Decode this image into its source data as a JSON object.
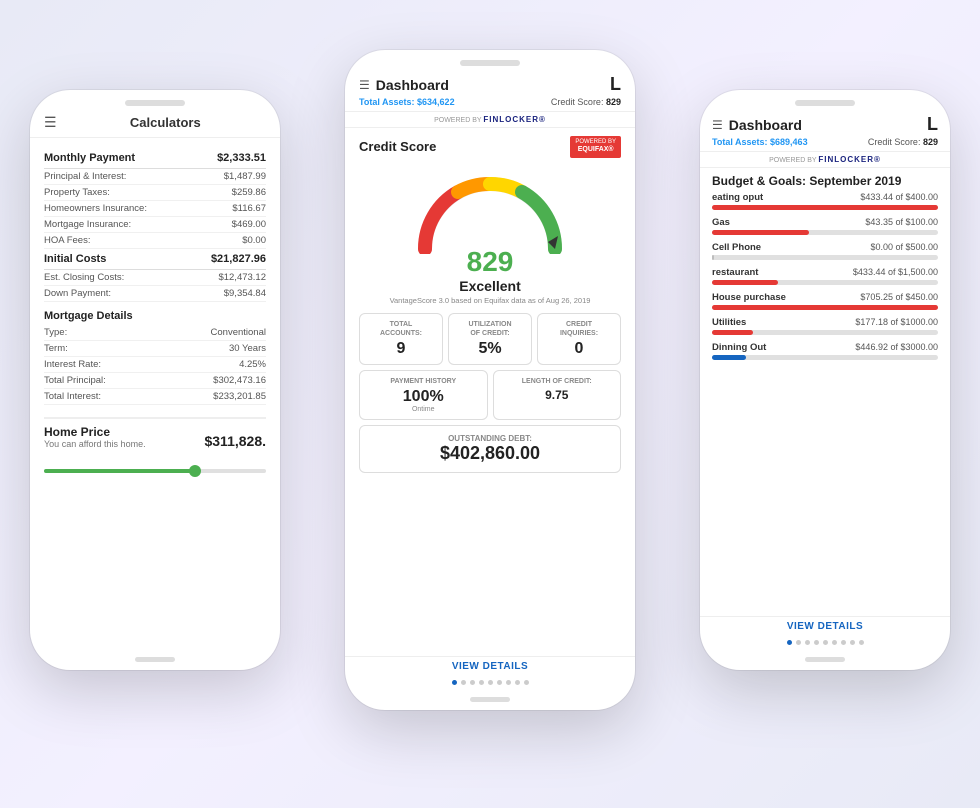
{
  "left_phone": {
    "header": {
      "title": "Calculators"
    },
    "monthly_payment": {
      "label": "Monthly Payment",
      "value": "$2,333.51",
      "rows": [
        {
          "label": "Principal & Interest:",
          "value": "$1,487.99"
        },
        {
          "label": "Property Taxes:",
          "value": "$259.86"
        },
        {
          "label": "Homeowners Insurance:",
          "value": "$116.67"
        },
        {
          "label": "Mortgage Insurance:",
          "value": "$469.00"
        },
        {
          "label": "HOA Fees:",
          "value": "$0.00"
        }
      ]
    },
    "initial_costs": {
      "label": "Initial Costs",
      "value": "$21,827.96",
      "rows": [
        {
          "label": "Est. Closing Costs:",
          "value": "$12,473.12"
        },
        {
          "label": "Down Payment:",
          "value": "$9,354.84"
        }
      ]
    },
    "mortgage_details": {
      "label": "Mortgage Details",
      "rows": [
        {
          "label": "Type:",
          "value": "Conventional"
        },
        {
          "label": "Term:",
          "value": "30 Years"
        },
        {
          "label": "Interest Rate:",
          "value": "4.25%"
        },
        {
          "label": "Total Principal:",
          "value": "$302,473.16"
        },
        {
          "label": "Total Interest:",
          "value": "$233,201.85"
        }
      ]
    },
    "home_price": {
      "label": "Home Price",
      "sub": "You can afford this home.",
      "value": "$311,828."
    }
  },
  "center_phone": {
    "header": {
      "title": "Dashboard",
      "letter": "L",
      "total_assets_label": "Total Assets:",
      "total_assets_value": "$634,622",
      "credit_score_label": "Credit Score:",
      "credit_score_value": "829",
      "powered_by": "POWERED BY",
      "finlocker": "FINLOCKER®"
    },
    "credit_score": {
      "title": "Credit Score",
      "powered_by": "POWERED BY",
      "equifax": "EQUIFAX®",
      "score": "829",
      "rating": "Excellent",
      "sub": "VantageScore 3.0 based on Equifax data as of Aug 26, 2019",
      "stats": [
        {
          "label": "TOTAL\nACCOUNTS:",
          "value": "9",
          "sub": ""
        },
        {
          "label": "UTILIZATION\nOF CREDIT:",
          "value": "5%",
          "sub": ""
        },
        {
          "label": "CREDIT\nINQUIRIES:",
          "value": "0",
          "sub": ""
        }
      ],
      "stats2": [
        {
          "label": "PAYMENT HISTORY",
          "value": "100%",
          "sub": "Ontime"
        },
        {
          "label": "LENGTH OF CREDIT:",
          "value": "9.75",
          "sub": ""
        }
      ],
      "outstanding": {
        "label": "OUTSTANDING DEBT:",
        "value": "$402,860.00"
      },
      "view_details": "VIEW DETAILS"
    },
    "dots": [
      true,
      false,
      false,
      false,
      false,
      false,
      false,
      false,
      false
    ]
  },
  "right_phone": {
    "header": {
      "title": "Dashboard",
      "letter": "L",
      "total_assets_label": "Total Assets:",
      "total_assets_value": "$689,463",
      "credit_score_label": "Credit Score:",
      "credit_score_value": "829",
      "powered_by": "POWERED BY",
      "finlocker": "FINLOCKER®"
    },
    "budget": {
      "section_title": "Budget & Goals: September 2019",
      "items": [
        {
          "name": "eating oput",
          "detail": "$433.44 of $400.00",
          "pct": 108,
          "color": "red"
        },
        {
          "name": "Gas",
          "detail": "$43.35 of $100.00",
          "pct": 43,
          "color": "red"
        },
        {
          "name": "Cell Phone",
          "detail": "$0.00 of $500.00",
          "pct": 0,
          "color": "gray"
        },
        {
          "name": "restaurant",
          "detail": "$433.44 of $1,500.00",
          "pct": 29,
          "color": "red"
        },
        {
          "name": "House purchase",
          "detail": "$705.25 of $450.00",
          "pct": 100,
          "color": "red"
        },
        {
          "name": "Utilities",
          "detail": "$177.18 of $1000.00",
          "pct": 18,
          "color": "red"
        },
        {
          "name": "Dinning Out",
          "detail": "$446.92 of $3000.00",
          "pct": 15,
          "color": "blue"
        }
      ],
      "view_details": "VIEW DETAILS"
    },
    "dots": [
      true,
      false,
      false,
      false,
      false,
      false,
      false,
      false,
      false
    ]
  }
}
